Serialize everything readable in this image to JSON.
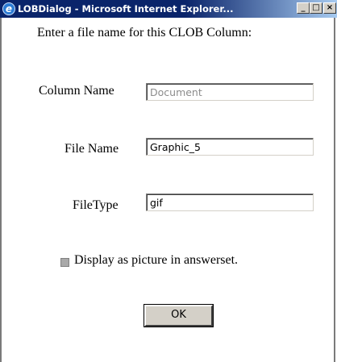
{
  "window": {
    "title": "LOBDialog - Microsoft Internet Explorer...",
    "icon": "ie-icon",
    "controls": {
      "minimize": "_",
      "maximize": "□",
      "close": "×"
    }
  },
  "form": {
    "prompt": "Enter a file name for this CLOB Column:",
    "column_name": {
      "label": "Column Name",
      "value": "Document",
      "disabled": true
    },
    "file_name": {
      "label": "File Name",
      "value": "Graphic_5"
    },
    "file_type": {
      "label": "FileType",
      "value": "gif"
    },
    "display_checkbox": {
      "label": "Display as picture in answerset.",
      "checked": false,
      "disabled": true
    },
    "ok_label": "OK"
  }
}
